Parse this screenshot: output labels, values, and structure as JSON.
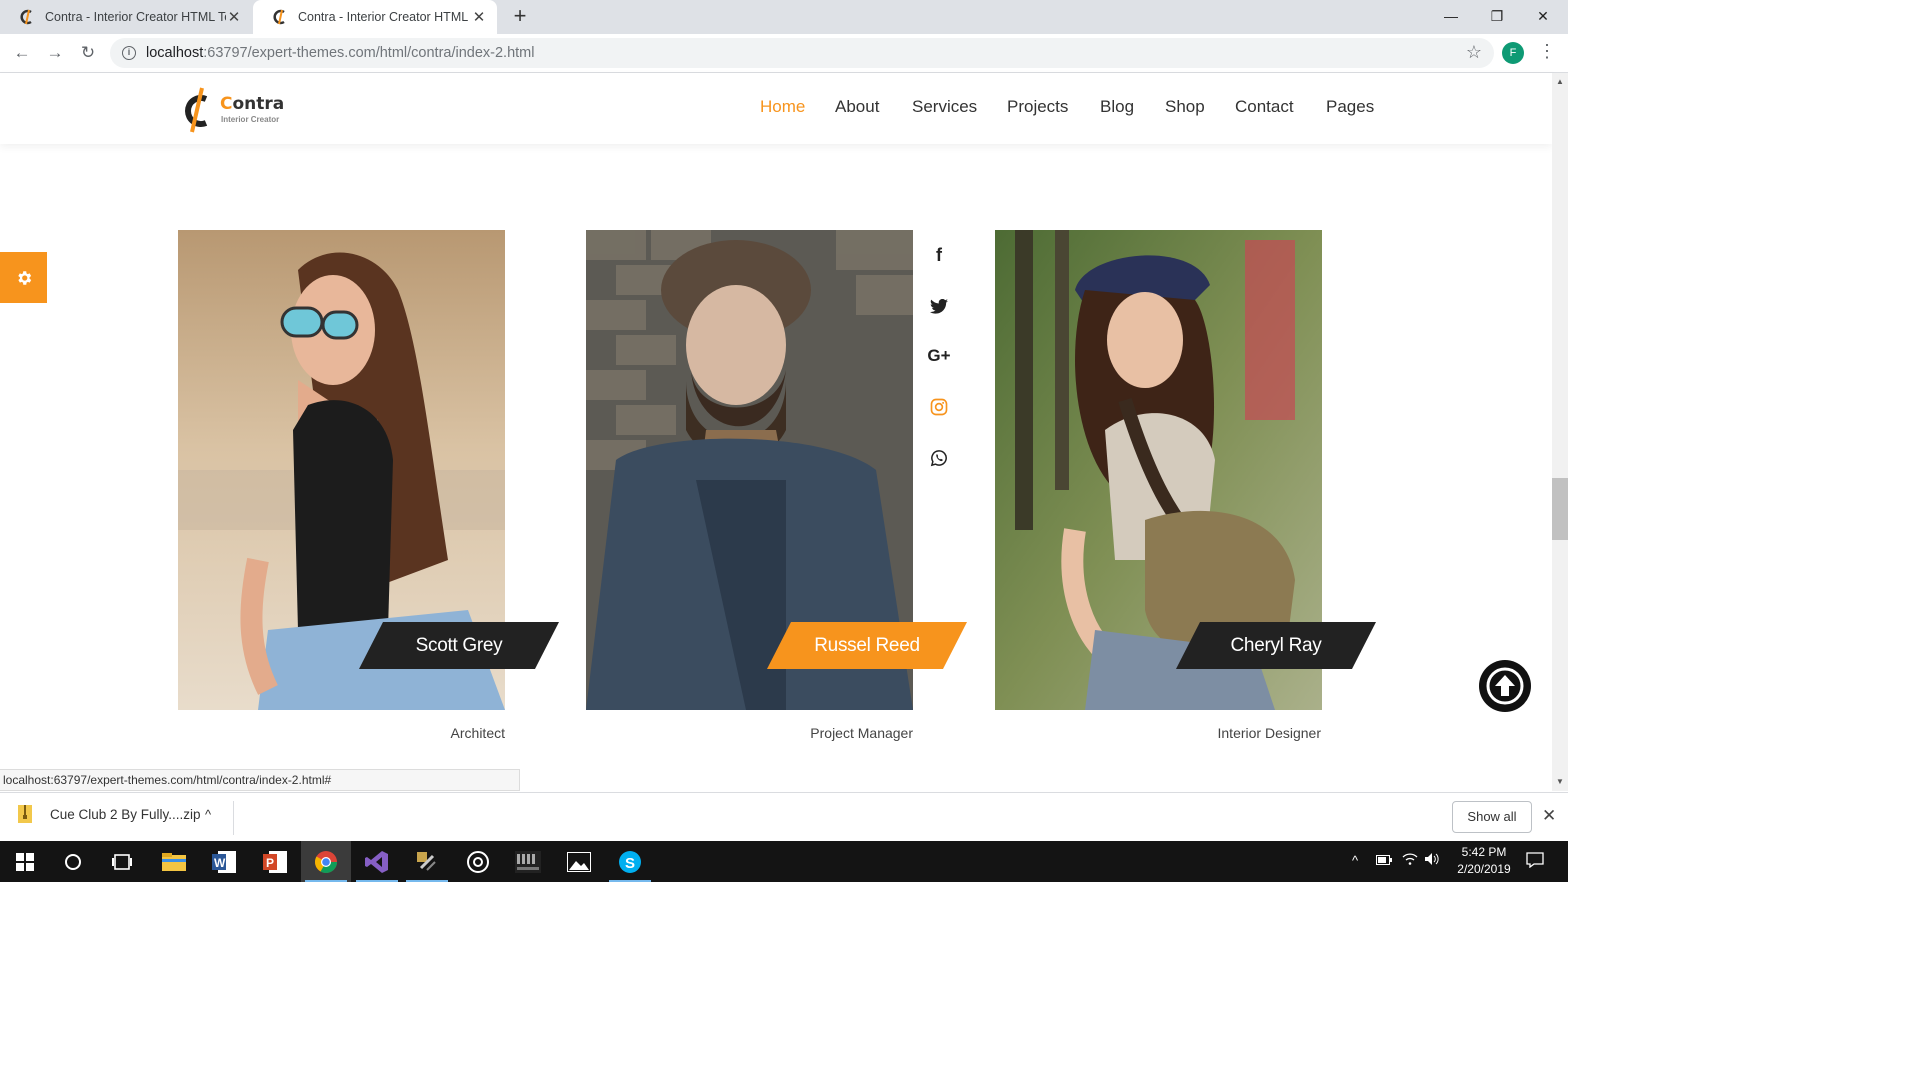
{
  "browser": {
    "tabs": [
      {
        "title": "Contra - Interior Creator HTML Te",
        "active": false
      },
      {
        "title": "Contra - Interior Creator HTML Te",
        "active": true
      }
    ],
    "new_tab": "+",
    "window_controls": {
      "minimize": "—",
      "maximize": "❐",
      "close": "✕"
    },
    "nav": {
      "back": "←",
      "forward": "→",
      "reload": "↻"
    },
    "url_host": "localhost",
    "url_path": ":63797/expert-themes.com/html/contra/index-2.html",
    "profile_initial": "F",
    "menu": "⋮"
  },
  "site": {
    "logo": {
      "brand_prefix": "C",
      "brand_rest": "ontra",
      "tagline": "Interior Creator"
    },
    "nav": [
      {
        "label": "Home",
        "active": true
      },
      {
        "label": "About",
        "active": false
      },
      {
        "label": "Services",
        "active": false
      },
      {
        "label": "Projects",
        "active": false
      },
      {
        "label": "Blog",
        "active": false
      },
      {
        "label": "Shop",
        "active": false
      },
      {
        "label": "Contact",
        "active": false
      },
      {
        "label": "Pages",
        "active": false
      }
    ],
    "accent": "#f7941d",
    "dark": "#222222"
  },
  "team": [
    {
      "name": "Scott Grey",
      "role": "Architect",
      "highlight": false
    },
    {
      "name": "Russel Reed",
      "role": "Project Manager",
      "highlight": true
    },
    {
      "name": "Cheryl Ray",
      "role": "Interior Designer",
      "highlight": false
    }
  ],
  "social_icons": [
    "facebook-icon",
    "twitter-icon",
    "google-plus-icon",
    "instagram-icon",
    "whatsapp-icon"
  ],
  "social_glyphs": {
    "facebook": "f",
    "google_plus": "G+"
  },
  "status_url": "localhost:63797/expert-themes.com/html/contra/index-2.html#",
  "downloads": {
    "file": "Cue Club 2 By Fully....zip",
    "chevron": "^",
    "show_all": "Show all",
    "close": "✕"
  },
  "taskbar": {
    "time": "5:42 PM",
    "date": "2/20/2019",
    "tray_up": "^"
  }
}
